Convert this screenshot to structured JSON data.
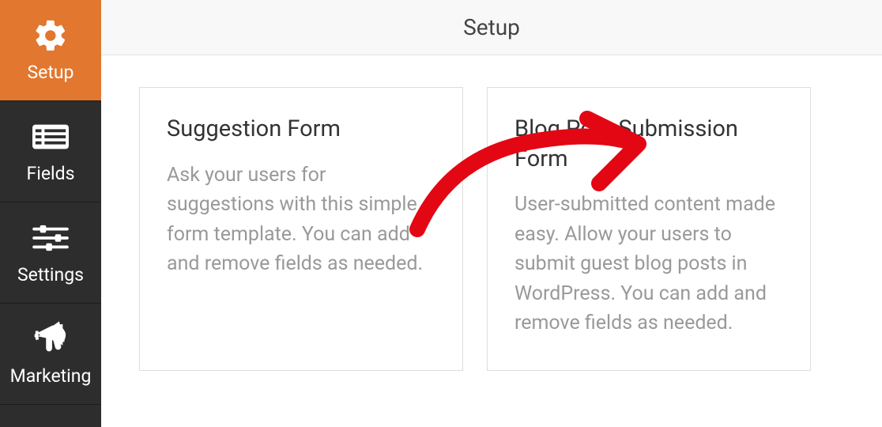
{
  "header": {
    "title": "Setup"
  },
  "sidebar": {
    "items": [
      {
        "label": "Setup",
        "icon": "gear-icon",
        "active": true
      },
      {
        "label": "Fields",
        "icon": "list-icon",
        "active": false
      },
      {
        "label": "Settings",
        "icon": "sliders-icon",
        "active": false
      },
      {
        "label": "Marketing",
        "icon": "bullhorn-icon",
        "active": false
      }
    ]
  },
  "templates": [
    {
      "title": "Suggestion Form",
      "description": "Ask your users for suggestions with this simple form template. You can add and remove fields as needed."
    },
    {
      "title": "Blog Post Submission Form",
      "description": "User-submitted content made easy. Allow your users to submit guest blog posts in WordPress. You can add and remove fields as needed."
    }
  ],
  "colors": {
    "accent": "#e27730",
    "sidebar_bg": "#2d2d2d",
    "annotation": "#e30613"
  }
}
